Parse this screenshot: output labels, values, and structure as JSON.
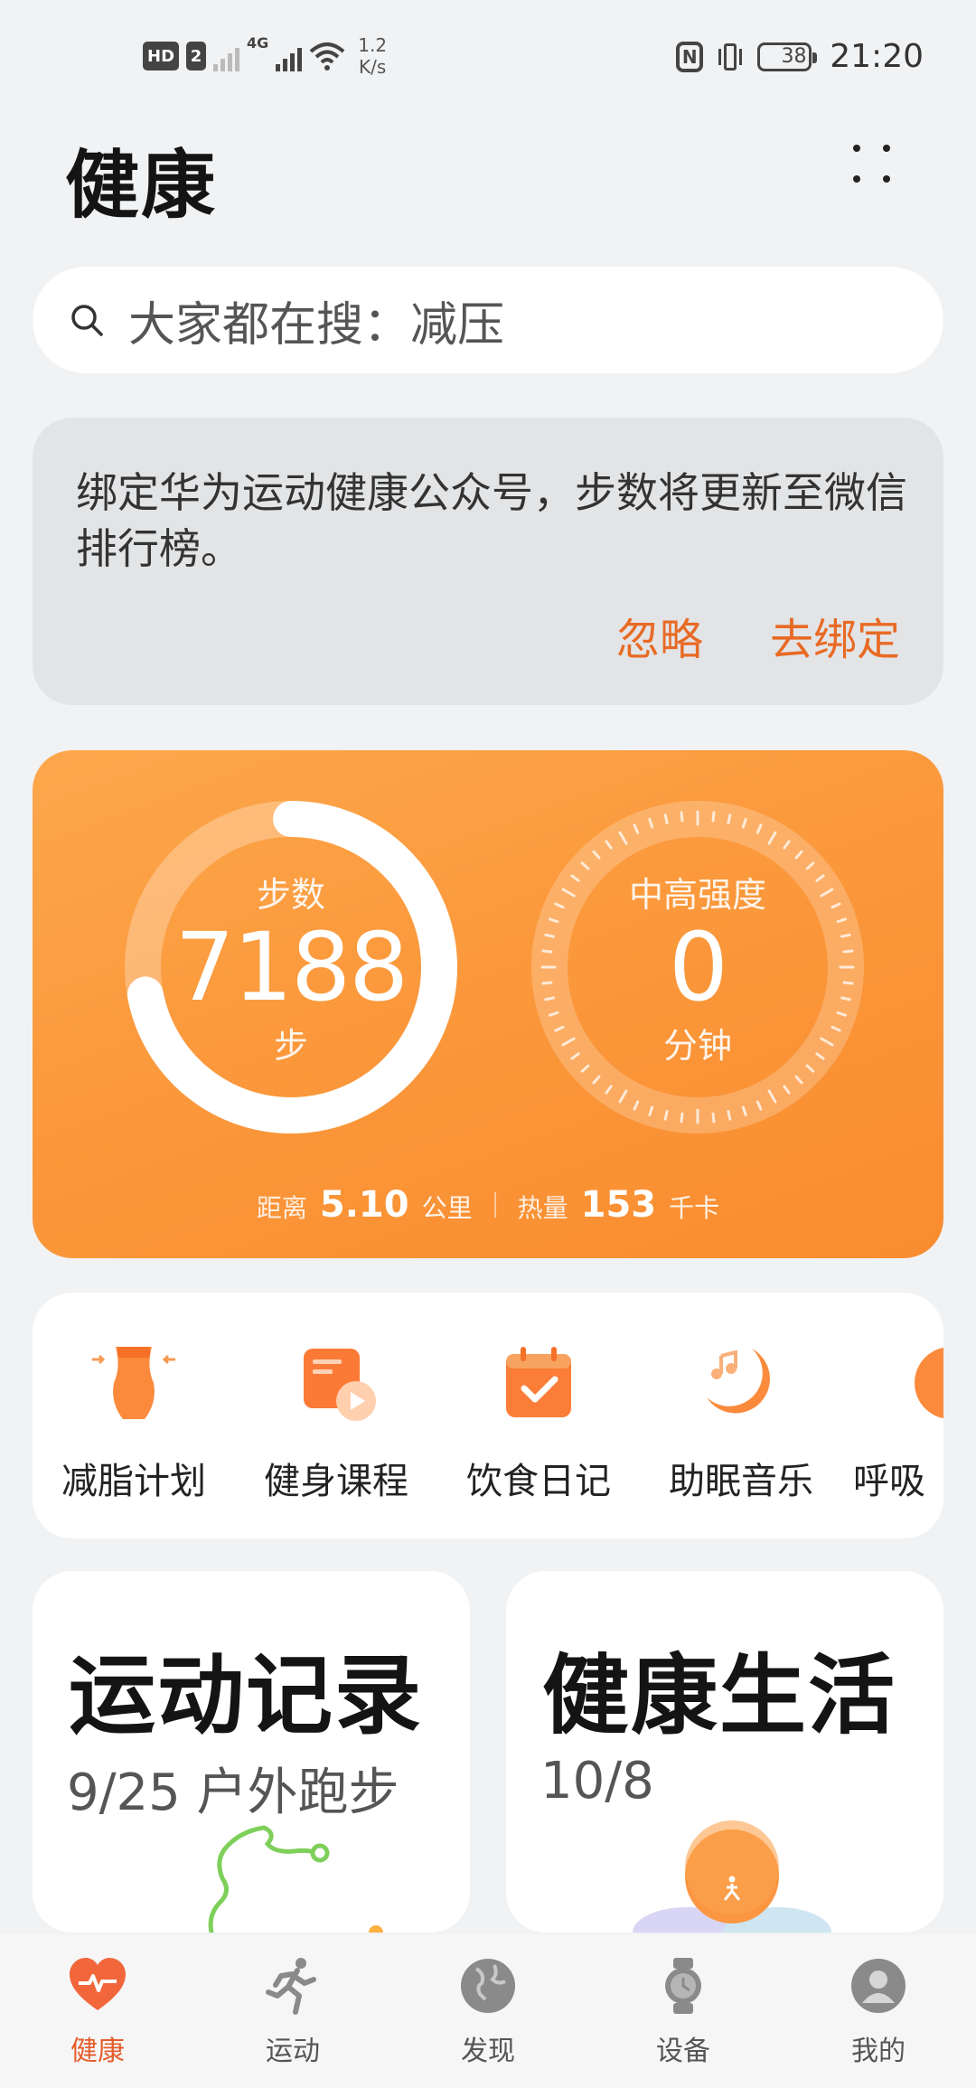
{
  "status_bar": {
    "hd": "HD",
    "sim": "2",
    "net_type": "4G",
    "speed_value": "1.2",
    "speed_unit": "K/s",
    "nfc": "N",
    "battery": "38",
    "time": "21:20"
  },
  "header": {
    "title": "健康",
    "more_icon": "more-grid-icon"
  },
  "search": {
    "placeholder": "大家都在搜：减压",
    "icon": "search-icon"
  },
  "banner": {
    "text": "绑定华为运动健康公众号，步数将更新至微信排行榜。",
    "ignore_label": "忽略",
    "bind_label": "去绑定"
  },
  "activity": {
    "steps": {
      "label": "步数",
      "value": "7188",
      "unit": "步",
      "progress": 0.72
    },
    "intensity": {
      "label": "中高强度",
      "value": "0",
      "unit": "分钟"
    },
    "distance": {
      "label": "距离",
      "value": "5.10",
      "unit": "公里"
    },
    "calories": {
      "label": "热量",
      "value": "153",
      "unit": "千卡"
    }
  },
  "tools": [
    {
      "label": "减脂计划",
      "icon": "waist-icon"
    },
    {
      "label": "健身课程",
      "icon": "course-play-icon"
    },
    {
      "label": "饮食日记",
      "icon": "calendar-check-icon"
    },
    {
      "label": "助眠音乐",
      "icon": "moon-music-icon"
    },
    {
      "label": "呼吸",
      "icon": "breath-icon"
    }
  ],
  "cards": {
    "exercise": {
      "title": "运动记录",
      "subtitle": "9/25 户外跑步"
    },
    "life": {
      "title": "健康生活",
      "subtitle": "10/8"
    }
  },
  "nav": [
    {
      "label": "健康",
      "icon": "heart-pulse-icon",
      "active": true
    },
    {
      "label": "运动",
      "icon": "running-icon",
      "active": false
    },
    {
      "label": "发现",
      "icon": "globe-icon",
      "active": false
    },
    {
      "label": "设备",
      "icon": "watch-icon",
      "active": false
    },
    {
      "label": "我的",
      "icon": "user-icon",
      "active": false
    }
  ],
  "colors": {
    "accent": "#e65c2a",
    "banner_action": "#e86a24",
    "card_orange": "#fb9a3d",
    "background": "#f1f2f4"
  }
}
